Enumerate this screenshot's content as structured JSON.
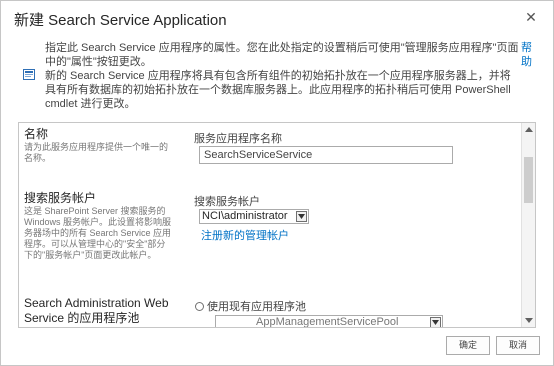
{
  "dialog": {
    "title": "新建 Search Service Application",
    "close_glyph": "✕",
    "description_line1": "指定此 Search Service 应用程序的属性。您在此处指定的设置稍后可使用\"管理服务应用程序\"页面中的\"属性\"按钮更改。",
    "description_line2": "新的 Search Service 应用程序将具有包含所有组件的初始拓扑放在一个应用程序服务器上，并将具有所有数据库的初始拓扑放在一个数据库服务器上。此应用程序的拓扑稍后可使用 PowerShell cmdlet 进行更改。",
    "help_link": "帮助"
  },
  "form": {
    "name_section": {
      "title": "名称",
      "description": "请为此服务应用程序提供一个唯一的名称。",
      "field_label": "服务应用程序名称",
      "field_value": "SearchServiceService"
    },
    "account_section": {
      "title": "搜索服务帐户",
      "description": "这是 SharePoint Server 搜索服务的 Windows 服务帐户。此设置将影响服务器场中的所有 Search Service 应用程序。可以从管理中心的\"安全\"部分下的\"服务帐户\"页面更改此帐户。",
      "field_label": "搜索服务帐户",
      "selected_account": "NCI\\administrator",
      "register_link": "注册新的管理帐户"
    },
    "app_pool_section": {
      "title": "Search Administration Web Service 的应用程序池",
      "radio_label": "使用现有应用程序池",
      "pool_value": "AppManagementServicePool"
    }
  },
  "buttons": {
    "ok": "确定",
    "cancel": "取消"
  },
  "colors": {
    "link": "#0072c6",
    "border": "#c6c6c6",
    "text": "#444444"
  },
  "icons": {
    "info": "info-icon",
    "close": "close-icon"
  }
}
